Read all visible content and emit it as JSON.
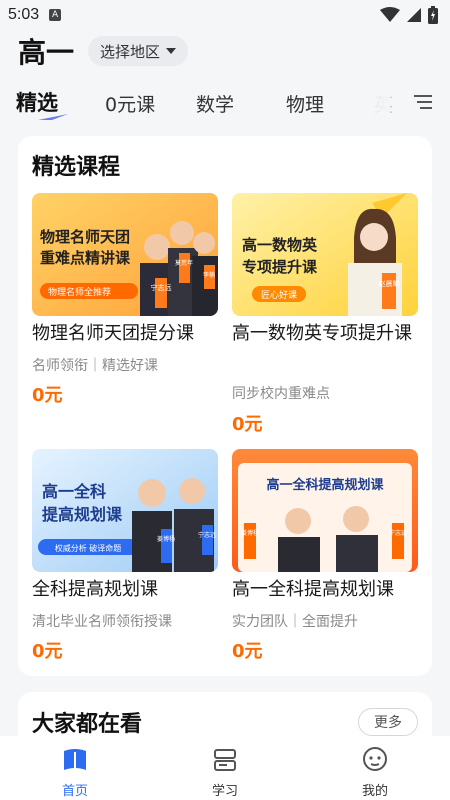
{
  "status": {
    "time": "5:03",
    "a_badge": "A"
  },
  "header": {
    "grade": "高一",
    "region_button": "选择地区"
  },
  "tabs": [
    {
      "label": "精选"
    },
    {
      "label": "0元课"
    },
    {
      "label": "数学"
    },
    {
      "label": "物理"
    },
    {
      "label": "英"
    }
  ],
  "featured": {
    "title": "精选课程",
    "courses": [
      {
        "title": "物理名师天团提分课",
        "subtitle": "名师领衔｜精选好课",
        "price": "0元",
        "banner": {
          "line1": "物理名师天团",
          "line2": "重难点精讲课",
          "tag": "物理名师全推荐",
          "names": [
            "宁志远",
            "莫荒年",
            "李楠"
          ]
        }
      },
      {
        "title": "高一数物英专项提升课",
        "subtitle": "同步校内重难点",
        "price": "0元",
        "banner": {
          "line1": "高一数物英",
          "line2": "专项提升课",
          "tag": "匠心好课",
          "names": [
            "赵晨曦"
          ]
        }
      },
      {
        "title": "全科提高规划课",
        "subtitle": "清北毕业名师领衔授课",
        "price": "0元",
        "banner": {
          "line1": "高一全科",
          "line2": "提高规划课",
          "tag": "权威分析 破译命题",
          "names": [
            "姜博杨",
            "宁志远"
          ]
        }
      },
      {
        "title": "高一全科提高规划课",
        "subtitle": "实力团队｜全面提升",
        "price": "0元",
        "banner": {
          "line1": "高一全科提高规划课",
          "line2": "",
          "tag": "",
          "names": [
            "姜博杨",
            "宁志远"
          ]
        }
      }
    ]
  },
  "popular": {
    "title": "大家都在看",
    "more": "更多"
  },
  "nav": [
    {
      "label": "首页",
      "icon": "home-icon"
    },
    {
      "label": "学习",
      "icon": "study-icon"
    },
    {
      "label": "我的",
      "icon": "profile-icon"
    }
  ],
  "colors": {
    "accent": "#2d6cf0",
    "price": "#ff6a00",
    "background": "#f5f6f8"
  }
}
